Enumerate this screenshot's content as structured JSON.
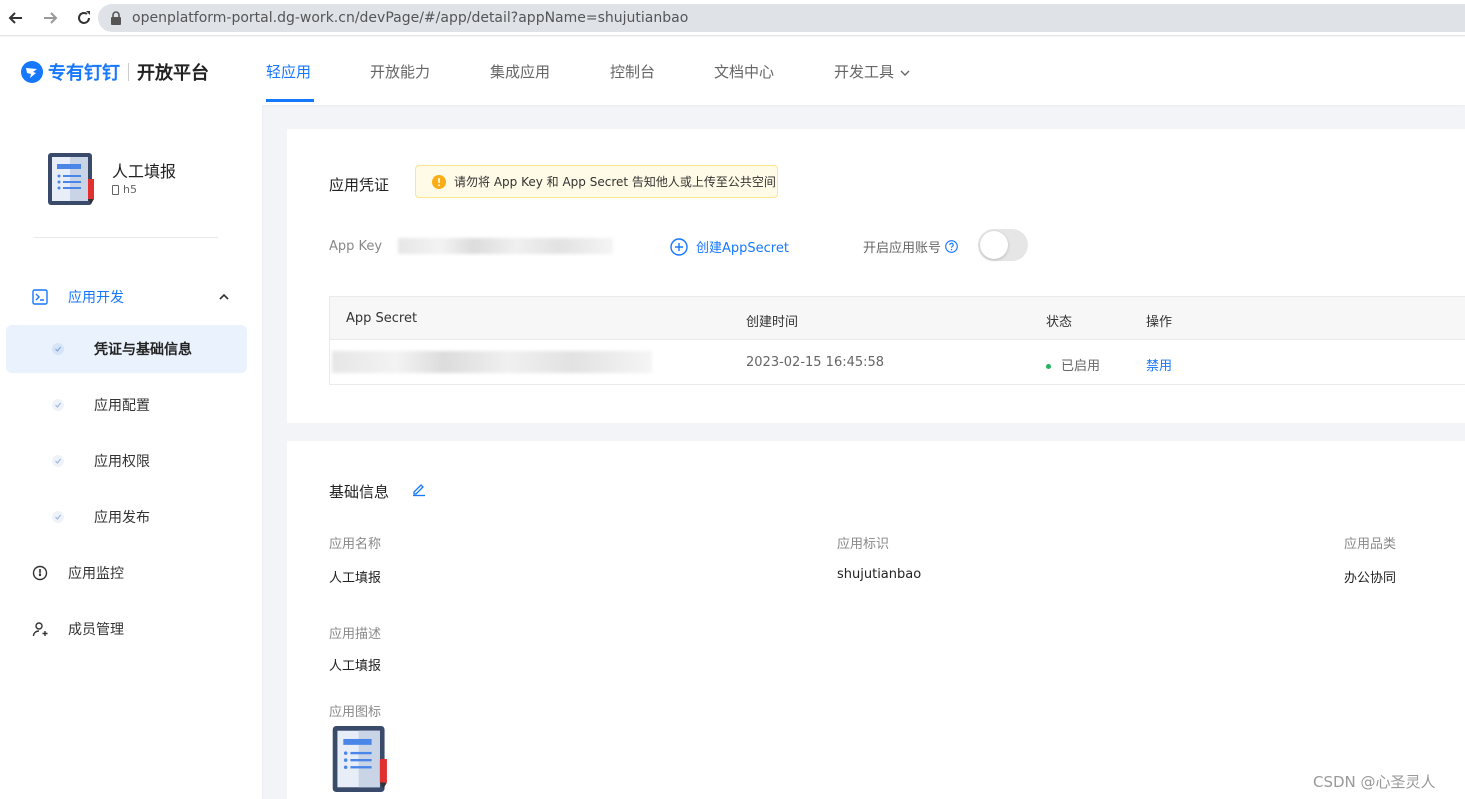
{
  "browser": {
    "url": "openplatform-portal.dg-work.cn/devPage/#/app/detail?appName=shujutianbao"
  },
  "brand": {
    "logo_text": "专有钉钉",
    "platform": "开放平台",
    "accent": "#1677ff"
  },
  "nav": {
    "tabs": [
      "轻应用",
      "开放能力",
      "集成应用",
      "控制台",
      "文档中心",
      "开发工具"
    ],
    "active_tab": "轻应用"
  },
  "sidebar": {
    "app_name": "人工填报",
    "app_type": "h5",
    "group_label": "应用开发",
    "sub_items": [
      "凭证与基础信息",
      "应用配置",
      "应用权限",
      "应用发布"
    ],
    "active_sub_item": "凭证与基础信息",
    "items": [
      "应用监控",
      "成员管理"
    ]
  },
  "credentials": {
    "title": "应用凭证",
    "warning": "请勿将 App Key 和 App Secret 告知他人或上传至公共空间",
    "app_key_label": "App Key",
    "create_secret": "创建AppSecret",
    "enable_account_label": "开启应用账号",
    "enable_account_on": false,
    "table": {
      "headers": [
        "App Secret",
        "创建时间",
        "状态",
        "操作"
      ],
      "rows": [
        {
          "created": "2023-02-15 16:45:58",
          "status": "已启用",
          "action": "禁用"
        }
      ]
    }
  },
  "basic_info": {
    "title": "基础信息",
    "name_label": "应用名称",
    "name_value": "人工填报",
    "id_label": "应用标识",
    "id_value": "shujutianbao",
    "category_label": "应用品类",
    "category_value": "办公协同",
    "desc_label": "应用描述",
    "desc_value": "人工填报",
    "icon_label": "应用图标"
  },
  "watermark": "CSDN @心圣灵人"
}
